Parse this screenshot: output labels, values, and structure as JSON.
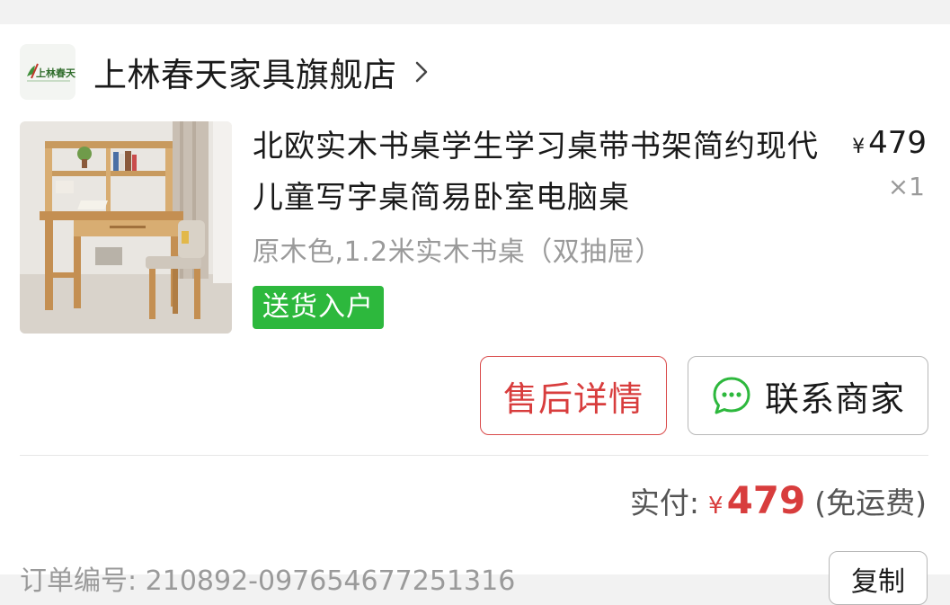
{
  "store": {
    "logo_text": "上林春天",
    "name": "上林春天家具旗舰店",
    "chevron_icon": "chevron-right-icon"
  },
  "product": {
    "title": "北欧实木书桌学生学习桌带书架简约现代儿童写字桌简易卧室电脑桌",
    "price_symbol": "¥",
    "price": "479",
    "quantity": "×1",
    "spec": "原木色,1.2米实木书桌（双抽屉）",
    "tag": "送货入户",
    "image": "desk-with-shelf-and-chair-photo"
  },
  "actions": {
    "after_sale_label": "售后详情",
    "contact_label": "联系商家",
    "contact_icon": "chat-bubble-icon"
  },
  "payment": {
    "label": "实付:",
    "symbol": "¥",
    "amount": "479",
    "note": "(免运费)"
  },
  "order": {
    "text": "订单编号:  210892-097654677251316",
    "copy_label": "复制"
  },
  "colors": {
    "accent_red": "#d83d3d",
    "tag_green": "#2db83d",
    "text_dark": "#1a1a1a",
    "text_gray": "#9a9a9a"
  }
}
